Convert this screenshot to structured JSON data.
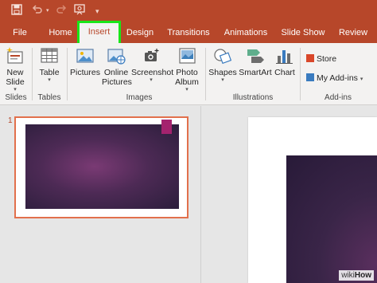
{
  "ribbon_tabs": [
    {
      "label": "File"
    },
    {
      "label": "Home"
    },
    {
      "label": "Insert"
    },
    {
      "label": "Design"
    },
    {
      "label": "Transitions"
    },
    {
      "label": "Animations"
    },
    {
      "label": "Slide Show"
    },
    {
      "label": "Review"
    }
  ],
  "ribbon": {
    "new_slide": {
      "line1": "New",
      "line2": "Slide"
    },
    "table": {
      "label": "Table"
    },
    "pictures": {
      "label": "Pictures"
    },
    "online_pictures": {
      "line1": "Online",
      "line2": "Pictures"
    },
    "screenshot": {
      "label": "Screenshot"
    },
    "photo_album": {
      "line1": "Photo",
      "line2": "Album"
    },
    "shapes": {
      "label": "Shapes"
    },
    "smartart": {
      "label": "SmartArt"
    },
    "chart": {
      "label": "Chart"
    },
    "store": {
      "label": "Store"
    },
    "my_addins": {
      "label": "My Add-ins"
    },
    "groups": {
      "slides": "Slides",
      "tables": "Tables",
      "images": "Images",
      "illustrations": "Illustrations",
      "addins": "Add-ins"
    }
  },
  "slide_panel": {
    "slide_number": "1"
  },
  "watermark": {
    "prefix": "wiki",
    "suffix": "How"
  },
  "colors": {
    "titlebar": "#b7472a",
    "active_tab_highlight": "#19e619",
    "slide_selection_border": "#e2704c",
    "slide_bg_dark": "#2c1e3c",
    "slide_accent": "#a4236e"
  },
  "icons": [
    "save-icon",
    "undo-icon",
    "redo-icon",
    "present-from-beginning-icon",
    "customize-quick-access-icon"
  ]
}
